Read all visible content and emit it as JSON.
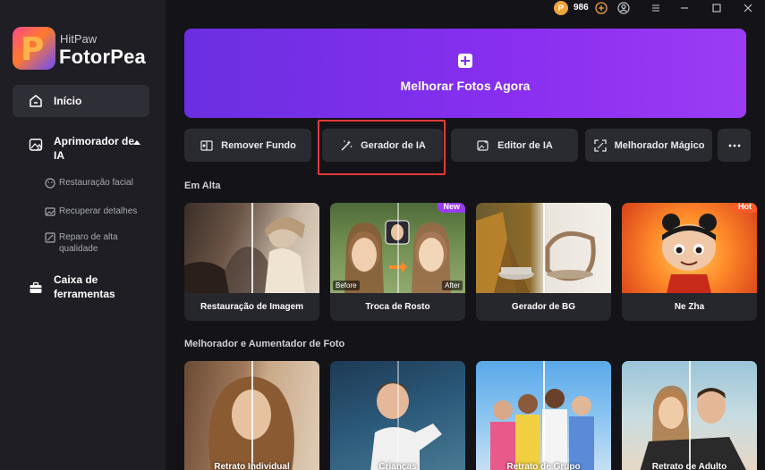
{
  "brand": {
    "small": "HitPaw",
    "name": "FotorPea"
  },
  "titlebar": {
    "coins": "986"
  },
  "sidebar": {
    "home": "Início",
    "enhancer_group": "Aprimorador de IA",
    "sub_items": [
      "Restauração facial",
      "Recuperar detalhes",
      "Reparo de alta qualidade"
    ],
    "toolbox": "Caixa de ferramentas"
  },
  "hero": {
    "label": "Melhorar Fotos Agora"
  },
  "tools": [
    "Remover Fundo",
    "Gerador de IA",
    "Editor de IA",
    "Melhorador Mágico"
  ],
  "sections": {
    "trending": "Em Alta",
    "enhancer": "Melhorador e Aumentador de Foto"
  },
  "trending_cards": [
    {
      "label": "Restauração de Imagem"
    },
    {
      "label": "Troca de Rosto",
      "badge": "New",
      "before": "Before",
      "after": "After"
    },
    {
      "label": "Gerador de BG"
    },
    {
      "label": "Ne Zha",
      "badge": "Hot"
    }
  ],
  "enhancer_cards": [
    {
      "label": "Retrato Individual"
    },
    {
      "label": "Crianças"
    },
    {
      "label": "Retrato de Grupo"
    },
    {
      "label": "Retrato de Adulto"
    }
  ],
  "colors": {
    "accent": "#7a30e8",
    "highlight": "#e23a3a",
    "badge_new": "#9b3cf4",
    "badge_hot": "#ff5a2a"
  }
}
